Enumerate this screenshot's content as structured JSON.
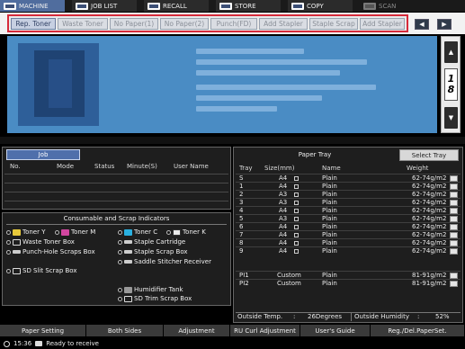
{
  "top_tabs": [
    {
      "label": "MACHINE",
      "state": "active"
    },
    {
      "label": "JOB LIST",
      "state": "inactive"
    },
    {
      "label": "RECALL",
      "state": "inactive"
    },
    {
      "label": "STORE",
      "state": "inactive"
    },
    {
      "label": "COPY",
      "state": "inactive"
    },
    {
      "label": "SCAN",
      "state": "disabled"
    }
  ],
  "indicator_tabs": [
    "Rep. Toner",
    "Waste Toner",
    "No Paper(1)",
    "No Paper(2)",
    "Punch(FD)",
    "Add Stapler",
    "Staple Scrap",
    "Add Stapler"
  ],
  "nav": {
    "prev": "◀",
    "next": "▶"
  },
  "page_indicator": {
    "current": "1",
    "total": "8",
    "up": "▲",
    "down": "▼"
  },
  "job": {
    "tab_label": "Job",
    "columns": [
      "No.",
      "Mode",
      "Status",
      "Minute(S)",
      "User Name"
    ]
  },
  "consumables": {
    "title": "Consumable and Scrap Indicators",
    "items": [
      "Toner Y",
      "Toner M",
      "Toner C",
      "Toner K",
      "Waste Toner Box",
      "Staple Cartridge",
      "Punch-Hole Scraps Box",
      "Staple Scrap Box",
      "Saddle Stitcher Receiver",
      "SD Slit Scrap Box",
      "Humidifier Tank",
      "SD Trim Scrap Box"
    ]
  },
  "tray": {
    "title": "Paper Tray",
    "select_button": "Select Tray",
    "columns": [
      "Tray",
      "Size(mm)",
      "Name",
      "Weight"
    ],
    "rows": [
      {
        "tray": "S",
        "size": "A4",
        "name": "Plain",
        "weight": "62-74g/m2"
      },
      {
        "tray": "1",
        "size": "A4",
        "name": "Plain",
        "weight": "62-74g/m2"
      },
      {
        "tray": "2",
        "size": "A3",
        "name": "Plain",
        "weight": "62-74g/m2"
      },
      {
        "tray": "3",
        "size": "A3",
        "name": "Plain",
        "weight": "62-74g/m2"
      },
      {
        "tray": "4",
        "size": "A4",
        "name": "Plain",
        "weight": "62-74g/m2"
      },
      {
        "tray": "5",
        "size": "A3",
        "name": "Plain",
        "weight": "62-74g/m2"
      },
      {
        "tray": "6",
        "size": "A4",
        "name": "Plain",
        "weight": "62-74g/m2"
      },
      {
        "tray": "7",
        "size": "A4",
        "name": "Plain",
        "weight": "62-74g/m2"
      },
      {
        "tray": "8",
        "size": "A4",
        "name": "Plain",
        "weight": "62-74g/m2"
      },
      {
        "tray": "9",
        "size": "A4",
        "name": "Plain",
        "weight": "62-74g/m2"
      },
      {
        "tray": "PI1",
        "size": "Custom",
        "name": "Plain",
        "weight": "81-91g/m2"
      },
      {
        "tray": "PI2",
        "size": "Custom",
        "name": "Plain",
        "weight": "81-91g/m2"
      }
    ],
    "outside_temp_label": "Outside Temp.",
    "outside_temp_value": "26Degrees",
    "outside_humidity_label": "Outside Humidity",
    "outside_humidity_value": "52%"
  },
  "function_bar": [
    "Paper Setting",
    "Both Sides",
    "Adjustment",
    "RU Curl Adjustment",
    "User's Guide",
    "Reg./Del.PaperSet."
  ],
  "status": {
    "time": "15:36",
    "message": "Ready to receive"
  },
  "colors": {
    "accent": "#506d9e",
    "message_bg": "#4a8cc4",
    "highlight_border": "#d62a3a"
  }
}
